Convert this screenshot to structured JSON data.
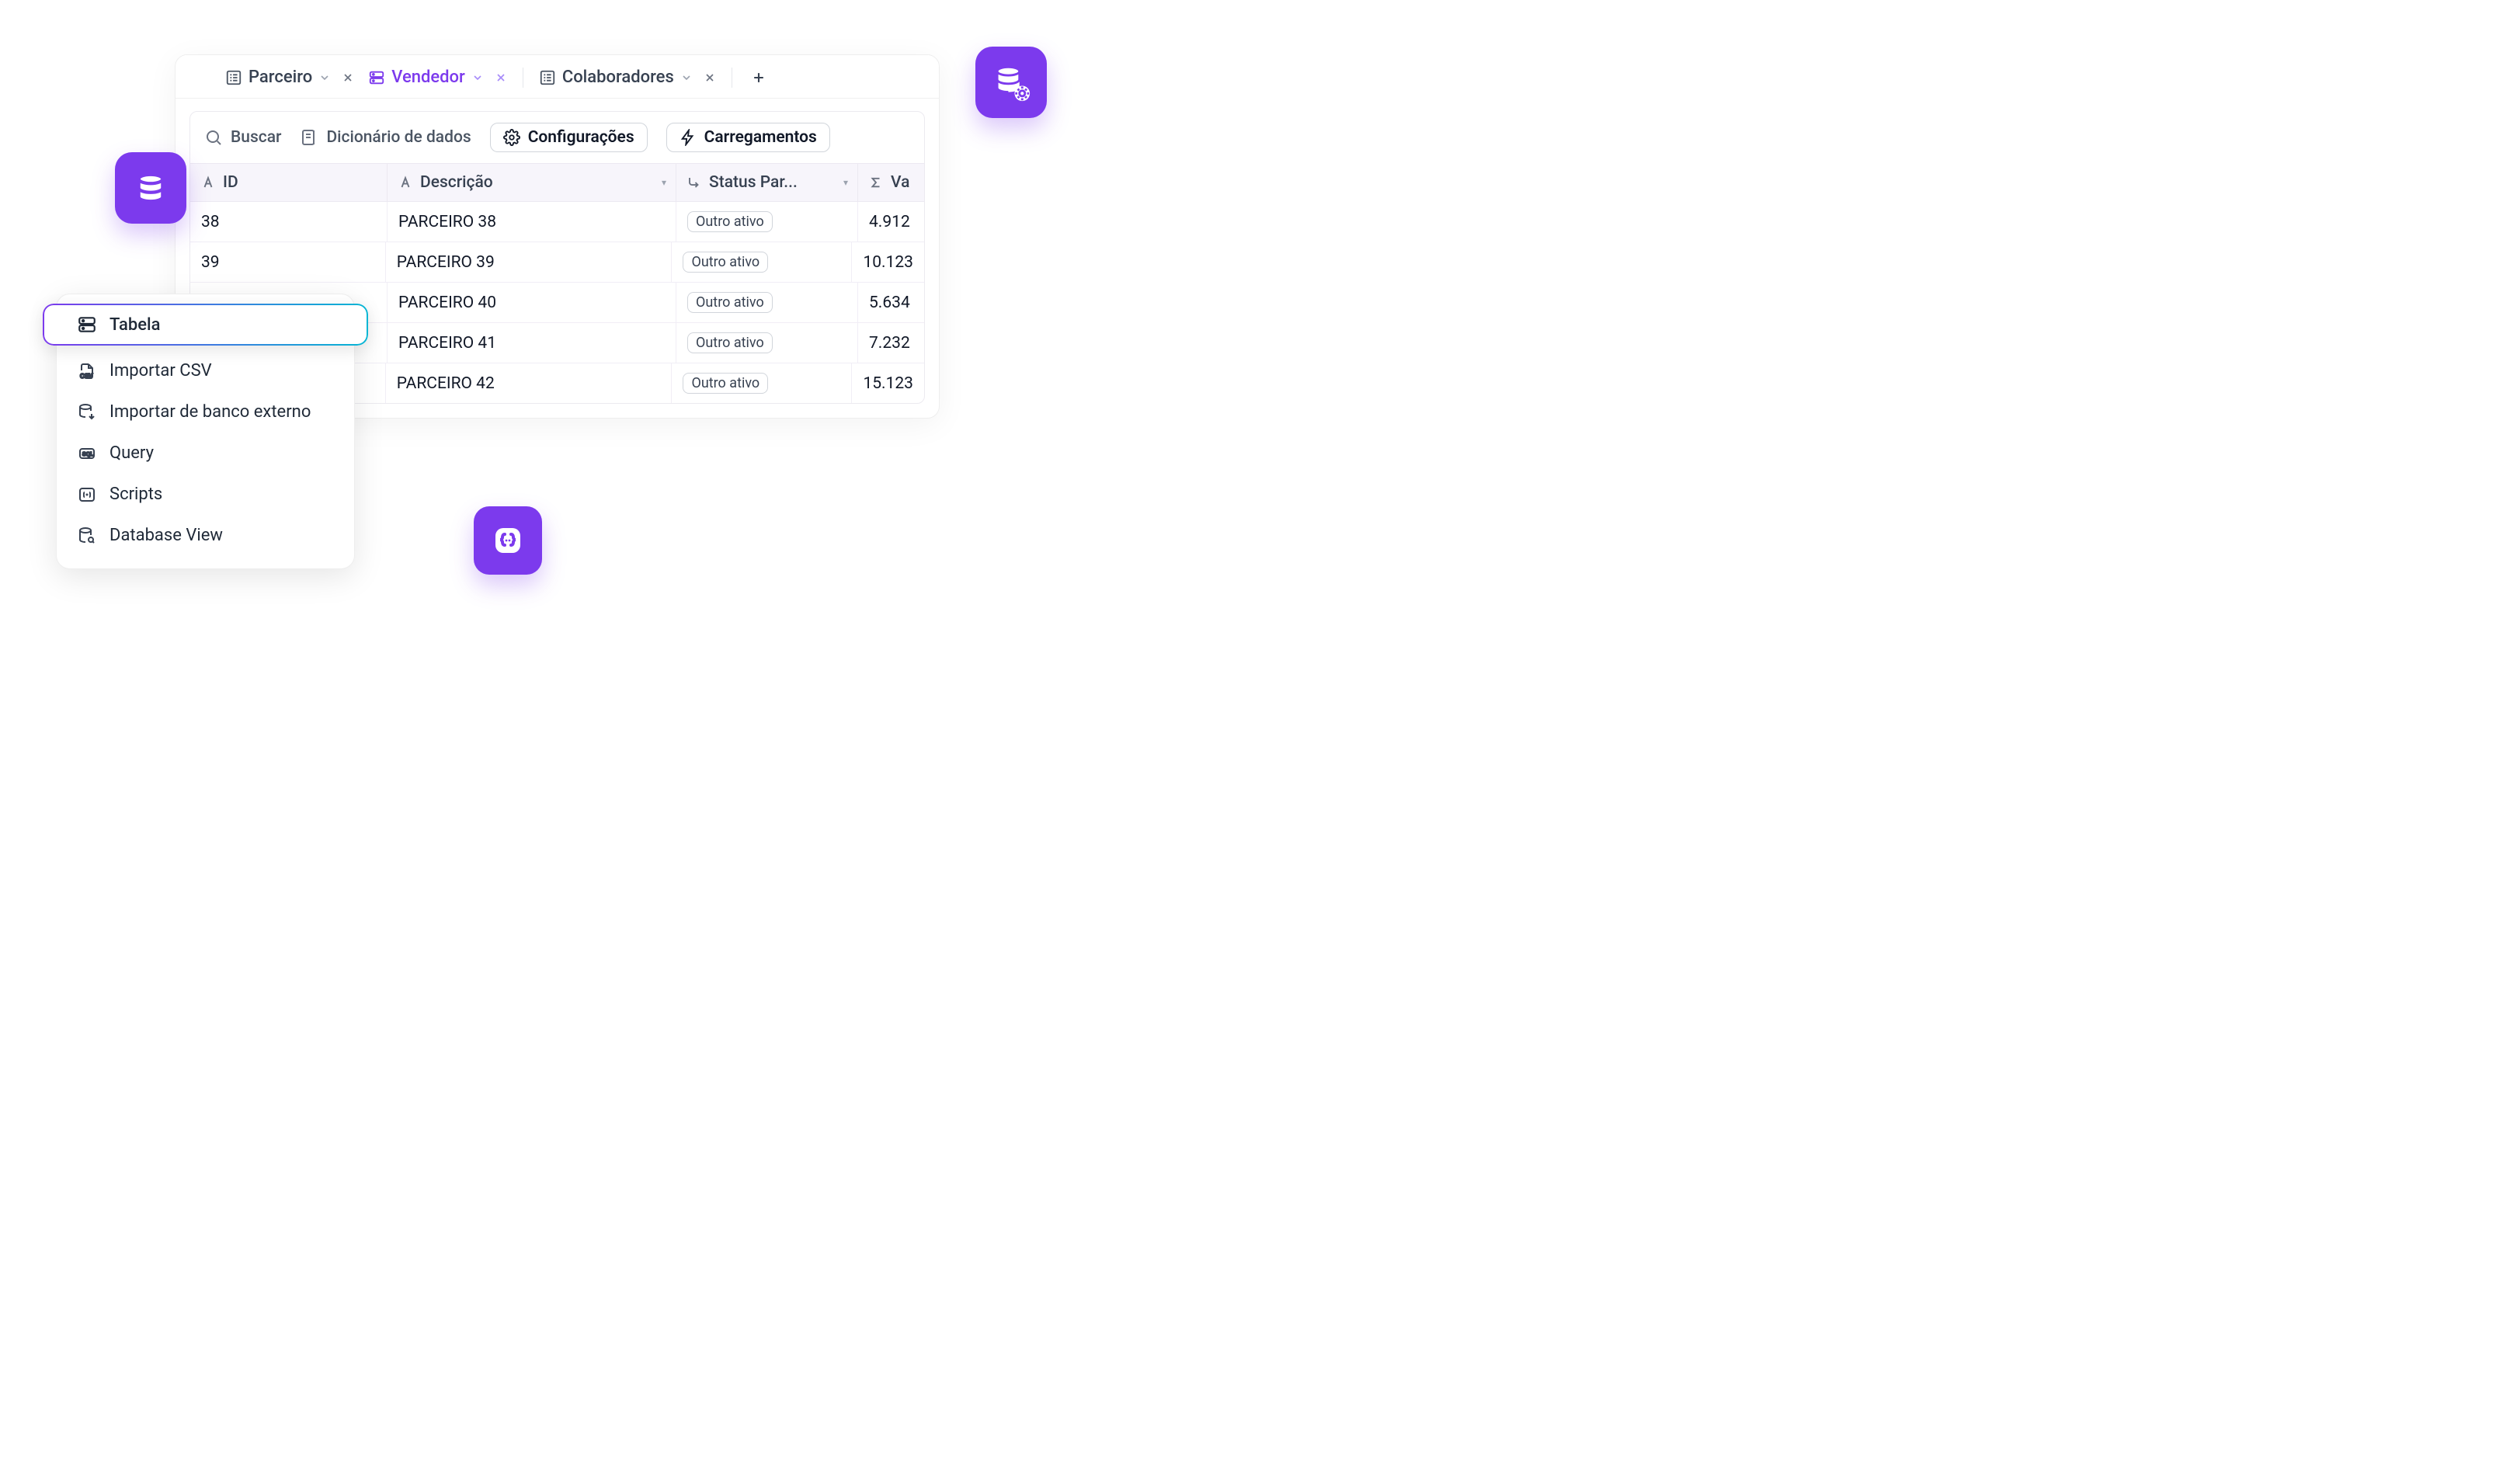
{
  "tabs": [
    {
      "label": "Parceiro",
      "active": false
    },
    {
      "label": "Vendedor",
      "active": true
    },
    {
      "label": "Colaboradores",
      "active": false
    }
  ],
  "toolbar": {
    "search": "Buscar",
    "dict": "Dicionário de dados",
    "config": "Configurações",
    "loads": "Carregamentos"
  },
  "columns": {
    "id": "ID",
    "desc": "Descrição",
    "status": "Status Par...",
    "val": "Va"
  },
  "rows": [
    {
      "id": "38",
      "desc": "PARCEIRO 38",
      "status": "Outro ativo",
      "val": "4.912"
    },
    {
      "id": "39",
      "desc": "PARCEIRO 39",
      "status": "Outro ativo",
      "val": "10.123"
    },
    {
      "id": "",
      "desc": "PARCEIRO 40",
      "status": "Outro ativo",
      "val": "5.634"
    },
    {
      "id": "",
      "desc": "PARCEIRO 41",
      "status": "Outro ativo",
      "val": "7.232"
    },
    {
      "id": "",
      "desc": "PARCEIRO 42",
      "status": "Outro ativo",
      "val": "15.123"
    }
  ],
  "menu": {
    "items": [
      {
        "label": "Tabela",
        "selected": true
      },
      {
        "label": "Importar CSV",
        "selected": false
      },
      {
        "label": "Importar de banco externo",
        "selected": false
      },
      {
        "label": "Query",
        "selected": false
      },
      {
        "label": "Scripts",
        "selected": false
      },
      {
        "label": "Database View",
        "selected": false
      }
    ]
  }
}
